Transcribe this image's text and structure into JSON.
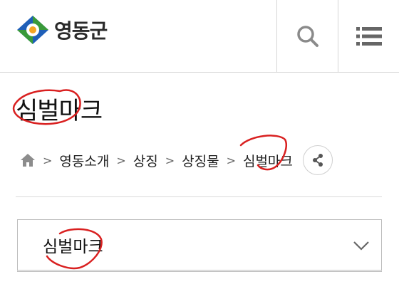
{
  "header": {
    "logo_text": "영동군",
    "search_icon": "search-icon",
    "menu_icon": "menu-icon"
  },
  "page": {
    "title": "심벌마크"
  },
  "breadcrumb": {
    "home_icon": "home-icon",
    "items": [
      "영동소개",
      "상징",
      "상징물",
      "심벌마크"
    ],
    "share_icon": "share-icon"
  },
  "select": {
    "value": "심벌마크",
    "chevron_icon": "chevron-down-icon"
  },
  "colors": {
    "logo_green": "#3a9a3a",
    "logo_blue": "#1f5fb8",
    "logo_orange": "#f5a623",
    "annotation_red": "#d92020"
  }
}
